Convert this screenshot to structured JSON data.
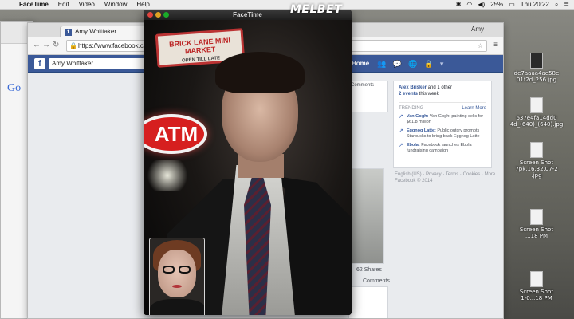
{
  "menubar": {
    "app_name": "FaceTime",
    "menus": [
      "Edit",
      "Video",
      "Window",
      "Help"
    ],
    "battery": "25%",
    "clock": "Thu 20:22"
  },
  "watermark": "MELBET",
  "desktop": {
    "files": [
      {
        "label_1": "de7aaaa4ae58e",
        "label_2": "01f2d_256.jpg",
        "style": "dark"
      },
      {
        "label_1": "637e4fa14dd0",
        "label_2": "4d_(640)_(640).jpg",
        "style": "light"
      },
      {
        "label_1": "Screen Shot",
        "label_2": "7pk.16.32.07-2",
        "label_3": ".jpg",
        "style": "light"
      },
      {
        "label_1": "Screen Shot",
        "label_2": "...18 PM",
        "style": "light"
      },
      {
        "label_1": "Screen Shot",
        "label_2": "1-0...18 PM",
        "style": "light"
      }
    ]
  },
  "browser": {
    "tab_title": "Amy Whittaker",
    "profile_name": "Amy",
    "url": "https://www.facebook.c",
    "back_window_logo": "Go"
  },
  "facebook": {
    "logo": "f",
    "search_value": "Amy Whittaker",
    "nav_home": "Home",
    "feed": {
      "card_text": "...",
      "comments_top": "Comments",
      "shares": "62 Shares",
      "comments_bottom": "Comments"
    },
    "sidebar": {
      "friend_line_name": "Alex Brisker",
      "friend_line_rest": " and 1 other",
      "events": "2 events",
      "events_rest": " this week",
      "trending_label": "TRENDING",
      "learn_more": "Learn More",
      "trends": [
        {
          "topic": "Van Gogh:",
          "text": " Van Gogh: painting sells for $61.8 million"
        },
        {
          "topic": "Eggnog Latte:",
          "text": " Public outcry prompts Starbucks to bring back Eggnog Latte"
        },
        {
          "topic": "Ebola:",
          "text": " Facebook launches Ebola fundraising campaign"
        }
      ]
    },
    "footer": "English (US) · Privacy · Terms · Cookies · More",
    "copyright": "Facebook © 2014"
  },
  "facetime": {
    "title": "FaceTime",
    "sign_line1": "BRICK LANE MINI MARKET",
    "sign_line2": "OPEN TILL LATE",
    "atm_text": "ATM"
  }
}
